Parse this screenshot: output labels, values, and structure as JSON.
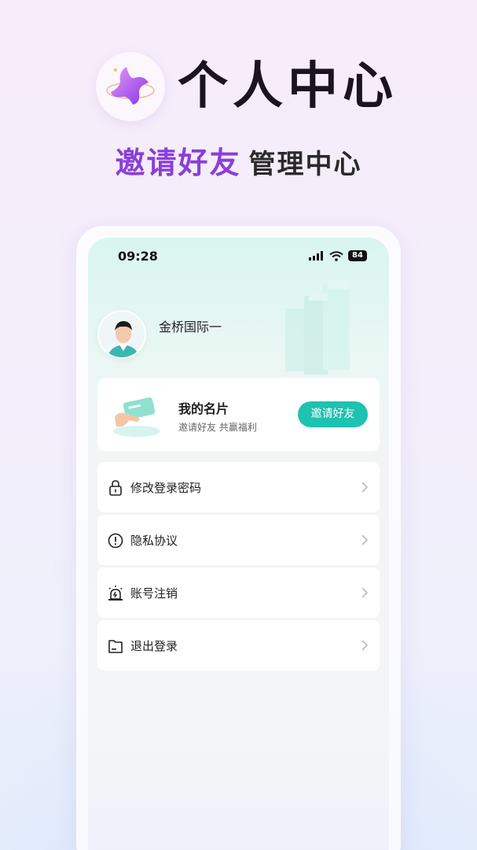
{
  "header": {
    "title": "个人中心",
    "subtitle_highlight": "邀请好友",
    "subtitle_rest": "管理中心",
    "accent_color": "#8a3fd8"
  },
  "status_bar": {
    "time": "09:28",
    "battery": "84"
  },
  "profile": {
    "name": "金桥国际一"
  },
  "card": {
    "title": "我的名片",
    "subtitle": "邀请好友 共赢福利",
    "button_label": "邀请好友",
    "button_color": "#1ec3b0"
  },
  "menu": {
    "items": [
      {
        "label": "修改登录密码",
        "icon": "lock-icon"
      },
      {
        "label": "隐私协议",
        "icon": "alert-circle-icon"
      },
      {
        "label": "账号注销",
        "icon": "alarm-icon"
      },
      {
        "label": "退出登录",
        "icon": "folder-icon"
      }
    ]
  }
}
